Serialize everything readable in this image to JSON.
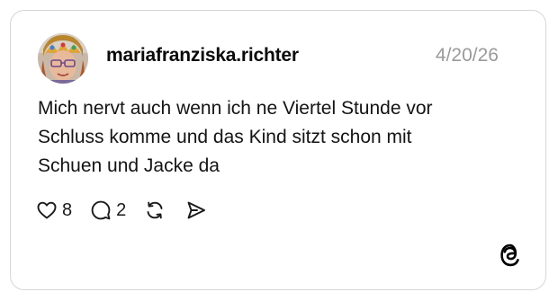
{
  "post": {
    "avatar_icon": "user-avatar-photo",
    "username": "mariafranziska.richter",
    "date": "4/20/26",
    "text_lines": [
      "Mich nervt auch wenn ich ne Viertel Stunde vor",
      "Schluss komme und das Kind sitzt schon mit",
      "Schuen und Jacke da"
    ]
  },
  "actions": {
    "like_icon": "heart-icon",
    "like_count": "8",
    "reply_icon": "speech-bubble-icon",
    "reply_count": "2",
    "repost_icon": "repost-icon",
    "share_icon": "send-icon"
  },
  "brand": {
    "logo_icon": "threads-logo-icon"
  }
}
